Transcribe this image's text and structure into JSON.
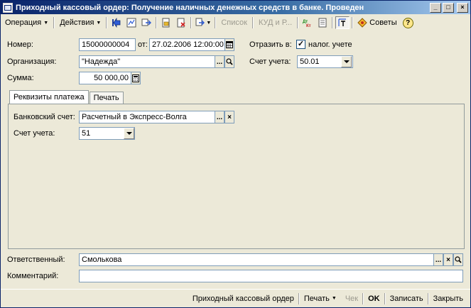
{
  "window": {
    "title": "Приходный кассовый ордер: Получение наличных денежных средств в банке. Проведен",
    "minimize_glyph": "_",
    "maximize_glyph": "□",
    "close_glyph": "×"
  },
  "toolbar": {
    "operation_label": "Операция",
    "actions_label": "Действия",
    "list_label": "Список",
    "kud_label": "КУД и Р...",
    "sovety_label": "Советы",
    "help_glyph": "?",
    "icons": [
      "back-arrow-icon",
      "structure-icon",
      "refresh-icon",
      "edit-doc-icon",
      "delete-doc-icon",
      "copy-doc-icon",
      "dt-kt-icon",
      "journal-icon",
      "settings-pressed-icon",
      "sovety-icon",
      "help-icon"
    ]
  },
  "form": {
    "number_label": "Номер:",
    "number_value": "15000000004",
    "date_label": "от:",
    "date_value": "27.02.2006 12:00:00",
    "reflect_label": "Отразить в:",
    "tax_accounting_label": "налог. учете",
    "tax_accounting_checked": true,
    "check_glyph": "✓",
    "org_label": "Организация:",
    "org_value": "\"Надежда\"",
    "account_label": "Счет учета:",
    "account_value": "50.01",
    "sum_label": "Сумма:",
    "sum_value": "50 000,00",
    "ellipsis": "...",
    "clear_glyph": "×"
  },
  "tabs": [
    {
      "label": "Реквизиты платежа",
      "active": true
    },
    {
      "label": "Печать",
      "active": false
    }
  ],
  "payment": {
    "bank_account_label": "Банковский счет:",
    "bank_account_value": "Расчетный в Экспресс-Волга",
    "account_label": "Счет учета:",
    "account_value": "51"
  },
  "footer_fields": {
    "responsible_label": "Ответственный:",
    "responsible_value": "Смолькова",
    "comment_label": "Комментарий:",
    "comment_value": ""
  },
  "statusbar": {
    "receipt_order_label": "Приходный кассовый ордер",
    "print_label": "Печать",
    "check_label": "Чек",
    "ok_label": "OK",
    "save_label": "Записать",
    "close_label": "Закрыть"
  },
  "colors": {
    "window_bg": "#ECE9D8",
    "titlebar_start": "#0A246A",
    "field_border": "#7F9DB9"
  }
}
